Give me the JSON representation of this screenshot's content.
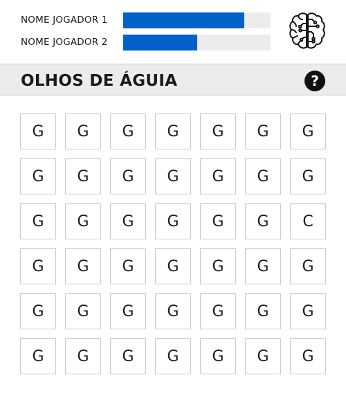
{
  "players": [
    {
      "name": "NOME JOGADOR 1",
      "progress": 0.82
    },
    {
      "name": "NOME JOGADOR 2",
      "progress": 0.5
    }
  ],
  "header": {
    "title": "OLHOS DE ÁGUIA",
    "help_label": "?"
  },
  "icons": {
    "brain": "brain-icon",
    "help": "question-mark-icon"
  },
  "colors": {
    "progress_fill": "#0062c8",
    "progress_track": "#ececec",
    "titlebar_bg": "#ececec"
  },
  "grid": {
    "columns": 7,
    "rows": [
      [
        "G",
        "G",
        "G",
        "G",
        "G",
        "G",
        "G"
      ],
      [
        "G",
        "G",
        "G",
        "G",
        "G",
        "G",
        "G"
      ],
      [
        "G",
        "G",
        "G",
        "G",
        "G",
        "G",
        "C"
      ],
      [
        "G",
        "G",
        "G",
        "G",
        "G",
        "G",
        "G"
      ],
      [
        "G",
        "G",
        "G",
        "G",
        "G",
        "G",
        "G"
      ],
      [
        "G",
        "G",
        "G",
        "G",
        "G",
        "G",
        "G"
      ]
    ]
  }
}
